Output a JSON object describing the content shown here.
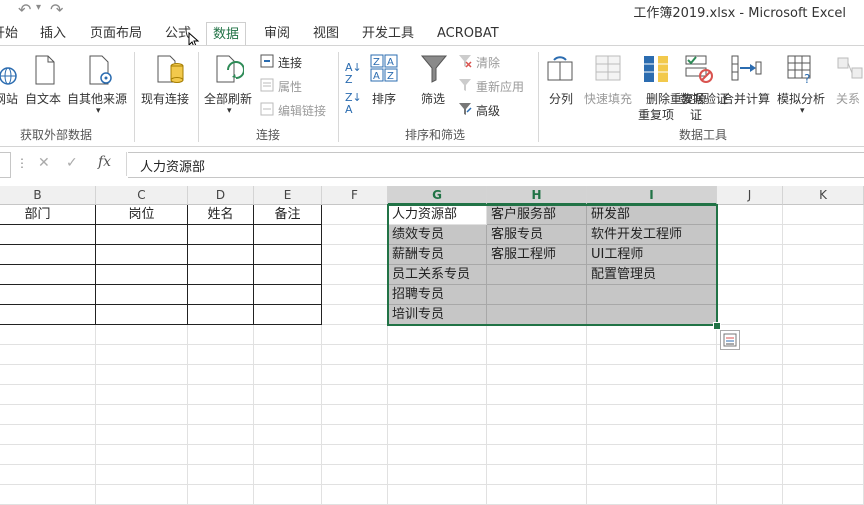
{
  "window": {
    "title": "工作簿2019.xlsx - Microsoft Excel"
  },
  "tabs": [
    "开始",
    "插入",
    "页面布局",
    "公式",
    "数据",
    "审阅",
    "视图",
    "开发工具",
    "ACROBAT"
  ],
  "active_tab": "数据",
  "ribbon": {
    "groups": [
      {
        "label": "获取外部数据",
        "buttons": [
          {
            "label": "网站",
            "icon": "web-icon"
          },
          {
            "label": "自文本",
            "icon": "text-file-icon"
          },
          {
            "label": "自其他来源",
            "icon": "other-source-icon"
          }
        ]
      },
      {
        "label": "",
        "buttons": [
          {
            "label": "现有连接",
            "icon": "existing-connection-icon"
          }
        ]
      },
      {
        "label": "连接",
        "buttons": [
          {
            "label": "全部刷新",
            "icon": "refresh-all-icon"
          }
        ],
        "small": [
          {
            "label": "连接",
            "enabled": true,
            "icon": "connection-icon"
          },
          {
            "label": "属性",
            "enabled": false,
            "icon": "properties-icon"
          },
          {
            "label": "编辑链接",
            "enabled": false,
            "icon": "edit-links-icon"
          }
        ]
      },
      {
        "label": "排序和筛选",
        "buttons": [
          {
            "label": "排序",
            "icon": "sort-icon"
          },
          {
            "label": "筛选",
            "icon": "filter-icon"
          }
        ],
        "small": [
          {
            "label": "清除",
            "enabled": false,
            "icon": "clear-icon"
          },
          {
            "label": "重新应用",
            "enabled": false,
            "icon": "reapply-icon"
          },
          {
            "label": "高级",
            "enabled": true,
            "icon": "advanced-filter-icon"
          }
        ]
      },
      {
        "label": "数据工具",
        "buttons": [
          {
            "label": "分列",
            "icon": "text-to-columns-icon"
          },
          {
            "label": "快速填充",
            "icon": "flash-fill-icon",
            "enabled": false
          },
          {
            "label": "删除重复项",
            "icon": "remove-duplicates-icon"
          },
          {
            "label": "数据验证",
            "icon": "data-validation-icon"
          },
          {
            "label": "合并计算",
            "icon": "consolidate-icon"
          },
          {
            "label": "模拟分析",
            "icon": "what-if-icon"
          },
          {
            "label": "关系",
            "icon": "relationships-icon",
            "enabled": false
          }
        ]
      }
    ]
  },
  "formula_bar": {
    "fx": "fx",
    "value": "人力资源部"
  },
  "columns": [
    "B",
    "C",
    "D",
    "E",
    "F",
    "G",
    "H",
    "I",
    "J",
    "K"
  ],
  "table_headers": [
    "部门",
    "岗位",
    "姓名",
    "备注"
  ],
  "selection": {
    "G": [
      "人力资源部",
      "绩效专员",
      "薪酬专员",
      "员工关系专员",
      "招聘专员",
      "培训专员"
    ],
    "H": [
      "客户服务部",
      "客服专员",
      "客服工程师",
      "",
      "",
      ""
    ],
    "I": [
      "研发部",
      "软件开发工程师",
      "UI工程师",
      "配置管理员",
      "",
      ""
    ]
  },
  "colors": {
    "accent": "#217346",
    "selection_bg": "#c6c6c6"
  }
}
